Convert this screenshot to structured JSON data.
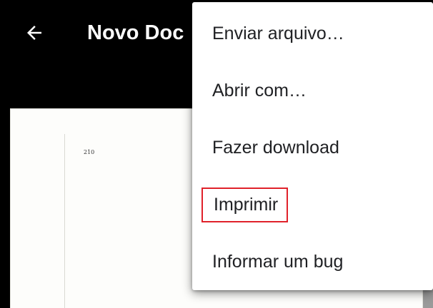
{
  "app_bar": {
    "back_icon": "arrow-back-icon",
    "title": "Novo Doc"
  },
  "document": {
    "page_number": "210"
  },
  "overflow_menu": {
    "items": [
      {
        "label": "Enviar arquivo…"
      },
      {
        "label": "Abrir com…"
      },
      {
        "label": "Fazer download"
      },
      {
        "label": "Imprimir",
        "highlighted": true
      },
      {
        "label": "Informar um bug"
      }
    ],
    "highlight_color": "#e0212a"
  }
}
